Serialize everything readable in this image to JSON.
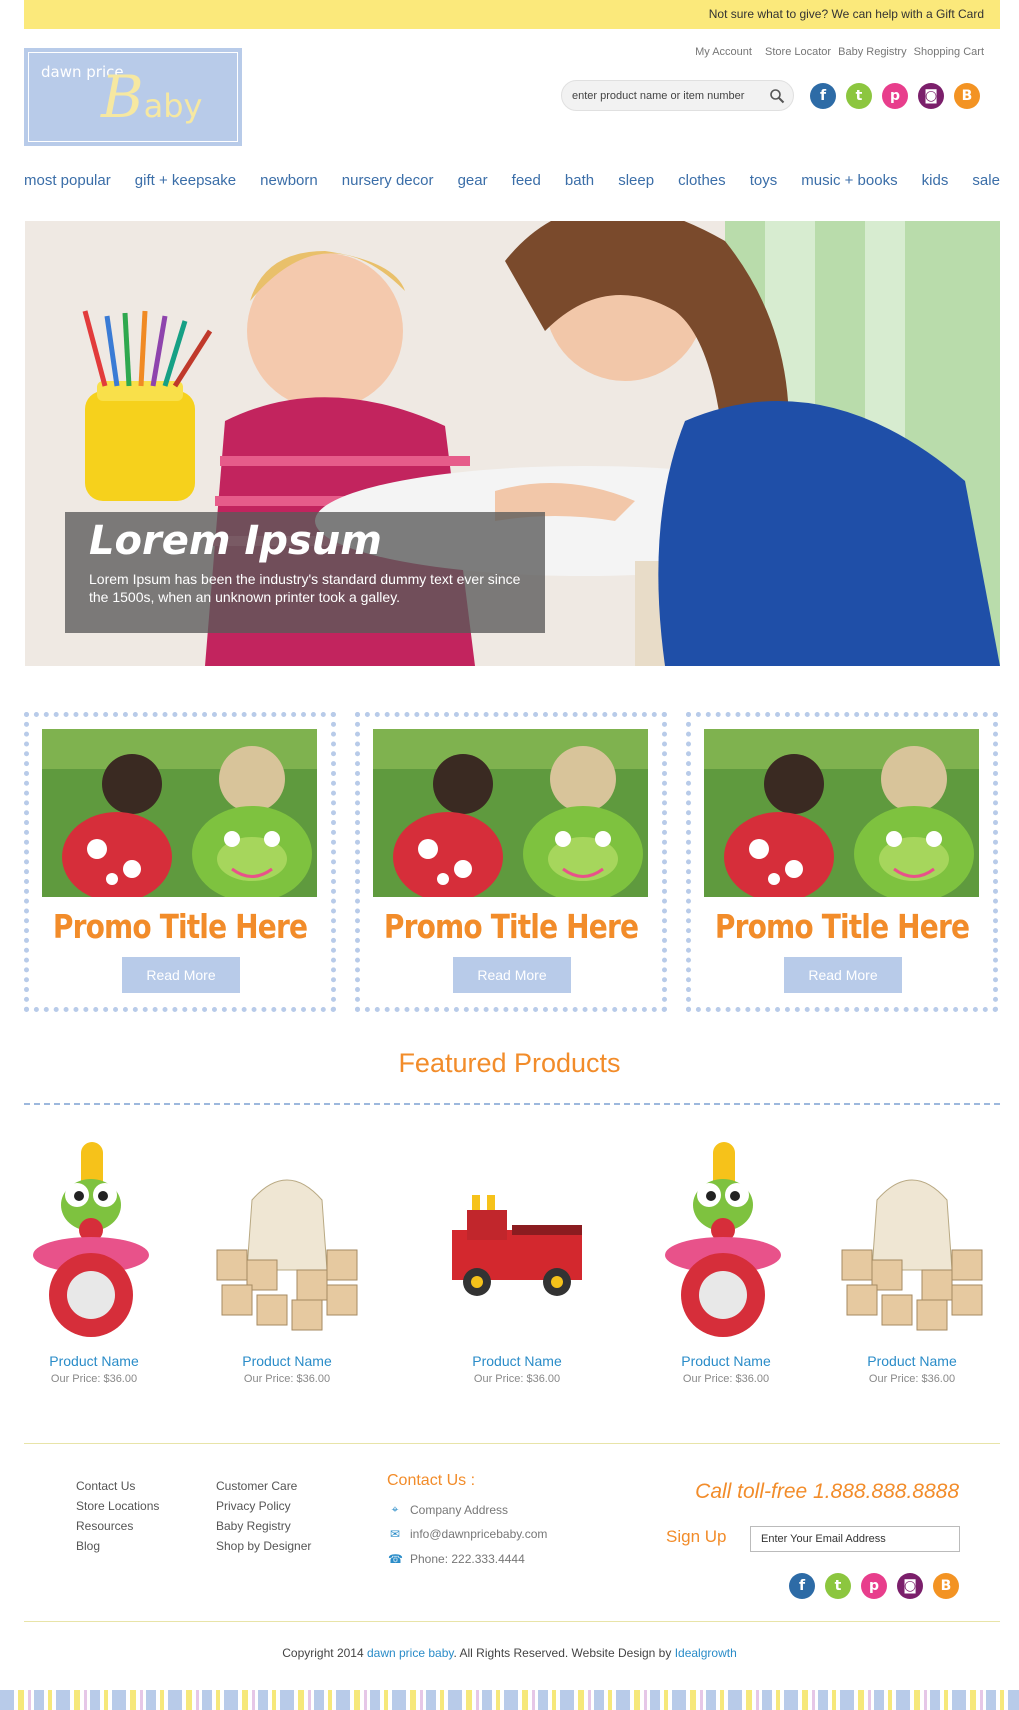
{
  "topbar": {
    "text": "Not sure what to give? We can help with a Gift Card"
  },
  "logo": {
    "line1": "dawn price",
    "big_letter": "B",
    "rest": "aby"
  },
  "util_links": [
    "My Account",
    "Store Locator",
    "Baby Registry",
    "Shopping Cart"
  ],
  "search": {
    "placeholder": "enter product name or item number"
  },
  "social": {
    "icons": [
      {
        "name": "facebook-icon",
        "glyph": "f",
        "color": "#2d6ba6"
      },
      {
        "name": "twitter-icon",
        "glyph": "t",
        "color": "#8cc63f"
      },
      {
        "name": "pinterest-icon",
        "glyph": "p",
        "color": "#e83e8c"
      },
      {
        "name": "instagram-icon",
        "glyph": "◙",
        "color": "#7b1f6b"
      },
      {
        "name": "blogger-icon",
        "glyph": "B",
        "color": "#f39323"
      }
    ]
  },
  "nav": [
    "most popular",
    "gift + keepsake",
    "newborn",
    "nursery decor",
    "gear",
    "feed",
    "bath",
    "sleep",
    "clothes",
    "toys",
    "music + books",
    "kids",
    "sale"
  ],
  "hero": {
    "title": "Lorem Ipsum",
    "text": "Lorem Ipsum has been the industry's standard dummy text ever since the 1500s, when an unknown printer took a galley."
  },
  "promos": [
    {
      "title": "Promo Title Here",
      "button": "Read More"
    },
    {
      "title": "Promo Title Here",
      "button": "Read More"
    },
    {
      "title": "Promo Title Here",
      "button": "Read More"
    }
  ],
  "featured": {
    "title": "Featured Products",
    "products": [
      {
        "name": "Product Name",
        "price": "Our Price: $36.00",
        "image": "rattle-toy"
      },
      {
        "name": "Product Name",
        "price": "Our Price: $36.00",
        "image": "alphabet-blocks"
      },
      {
        "name": "Product Name",
        "price": "Our Price: $36.00",
        "image": "fire-truck"
      },
      {
        "name": "Product Name",
        "price": "Our Price: $36.00",
        "image": "rattle-toy"
      },
      {
        "name": "Product Name",
        "price": "Our Price: $36.00",
        "image": "alphabet-blocks"
      }
    ]
  },
  "footer": {
    "col1": [
      "Contact Us",
      "Store Locations",
      "Resources",
      "Blog"
    ],
    "col2": [
      "Customer Care",
      "Privacy Policy",
      "Baby Registry",
      "Shop by Designer"
    ],
    "contact_title": "Contact Us :",
    "address": "Company Address",
    "email": "info@dawnpricebaby.com",
    "phone": "Phone: 222.333.4444",
    "call": "Call toll-free 1.888.888.8888",
    "signup_label": "Sign Up",
    "signup_placeholder": "Enter Your Email Address",
    "copyright_pre": "Copyright 2014",
    "copyright_brand": "dawn price baby",
    "copyright_mid": ". All Rights Reserved. Website Design by",
    "copyright_designer": "Idealgrowth"
  },
  "colors": {
    "accent_orange": "#f28c2a",
    "nav_blue": "#3b6ea8",
    "brand_blue": "#b8cbe9",
    "banner_yellow": "#fbe97b"
  }
}
